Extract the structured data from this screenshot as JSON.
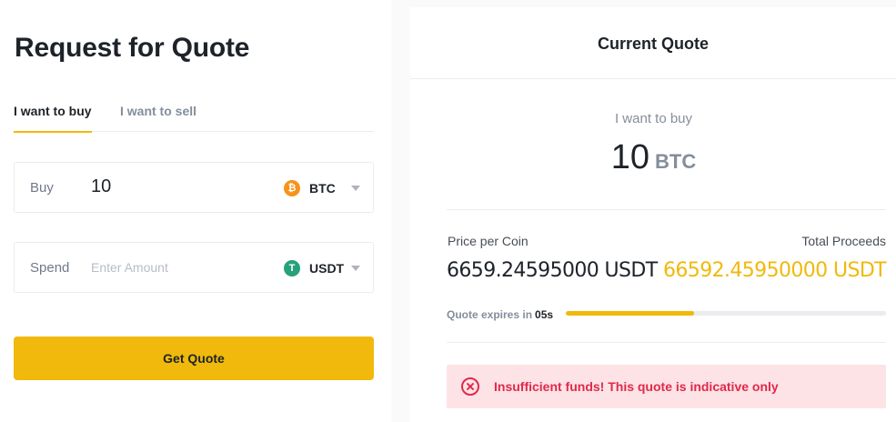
{
  "rfq": {
    "title": "Request for Quote",
    "tabs": [
      {
        "label": "I want to buy",
        "active": true
      },
      {
        "label": "I want to sell",
        "active": false
      }
    ],
    "buy": {
      "label": "Buy",
      "value": "10",
      "coin": "BTC",
      "coin_icon": "bitcoin-icon"
    },
    "spend": {
      "label": "Spend",
      "placeholder": "Enter Amount",
      "value": "",
      "coin": "USDT",
      "coin_icon": "tether-icon"
    },
    "get_quote_label": "Get Quote"
  },
  "quote": {
    "title": "Current Quote",
    "want_label": "I want to buy",
    "amount": "10",
    "coin": "BTC",
    "price_label": "Price per Coin",
    "price_value": "6659.24595000 USDT",
    "total_label": "Total Proceeds",
    "total_value": "66592.45950000 USDT",
    "expires_label": "Quote expires in",
    "expires_value": "05s",
    "expires_progress": 0.4,
    "alert_text": "Insufficient funds! This quote is indicative only",
    "alert_icon": "close-circle-icon"
  },
  "colors": {
    "accent": "#f0b90b",
    "error": "#e0294a",
    "error_bg": "#fde3e6",
    "btc": "#f7931a",
    "usdt": "#26a17b"
  }
}
